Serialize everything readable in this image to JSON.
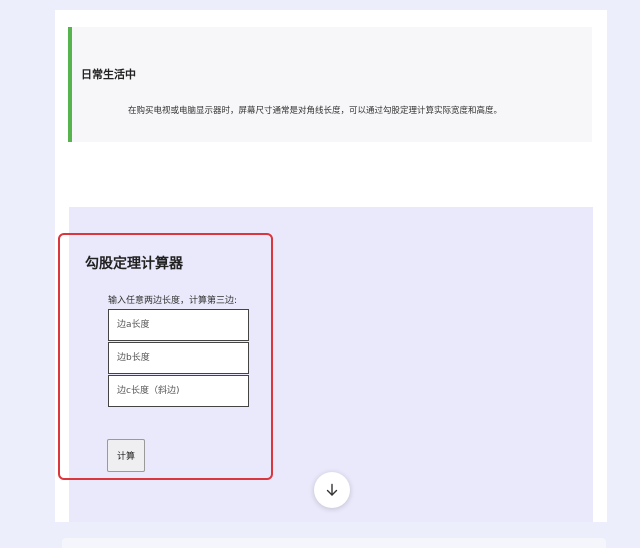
{
  "daily_life": {
    "title": "日常生活中",
    "text": "在购买电视或电脑显示器时，屏幕尺寸通常是对角线长度，可以通过勾股定理计算实际宽度和高度。"
  },
  "calculator": {
    "title": "勾股定理计算器",
    "hint": "输入任意两边长度，计算第三边:",
    "side_a_placeholder": "边a长度",
    "side_b_placeholder": "边b长度",
    "side_c_placeholder": "边c长度（斜边)",
    "button_label": "计算",
    "highlight_color": "#d9363e"
  },
  "colors": {
    "quote_accent": "#56b34e",
    "page_background": "#eceefb",
    "calc_background": "#e9e9fb"
  },
  "icons": {
    "scroll_down": "arrow-down-icon"
  }
}
